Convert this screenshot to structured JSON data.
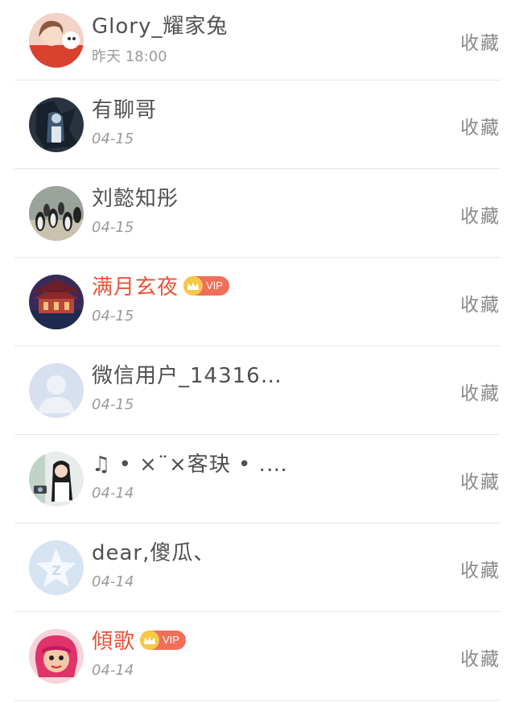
{
  "rows": [
    {
      "name": "Glory_耀家兔",
      "time": "昨天 18:00",
      "vip": false,
      "action": "收藏",
      "avatar": "avatar-girl-red"
    },
    {
      "name": "有聊哥",
      "time": "04-15",
      "vip": false,
      "action": "收藏",
      "avatar": "avatar-dark-figure"
    },
    {
      "name": "刘懿知彤",
      "time": "04-15",
      "vip": false,
      "action": "收藏",
      "avatar": "avatar-penguins"
    },
    {
      "name": "满月玄夜",
      "time": "04-15",
      "vip": true,
      "vip_label": "VIP",
      "action": "收藏",
      "avatar": "avatar-palace"
    },
    {
      "name": "微信用户_14316…",
      "time": "04-15",
      "vip": false,
      "action": "收藏",
      "avatar": "avatar-default-person"
    },
    {
      "name": "♫ • ×¨×客玦 • .…",
      "time": "04-14",
      "vip": false,
      "action": "收藏",
      "avatar": "avatar-girl-camera"
    },
    {
      "name": "dear,傻瓜、",
      "time": "04-14",
      "vip": false,
      "action": "收藏",
      "avatar": "avatar-qzone-star"
    },
    {
      "name": "傾歌",
      "time": "04-14",
      "vip": true,
      "vip_label": "VIP",
      "action": "收藏",
      "avatar": "avatar-cartoon-pink-hair"
    }
  ],
  "colors": {
    "vip_name": "#e8533a",
    "vip_badge": "#ef6f5a",
    "crown": "#f7c948",
    "text": "#505050",
    "time": "#9a9a9a",
    "divider": "#e6e6e6"
  }
}
